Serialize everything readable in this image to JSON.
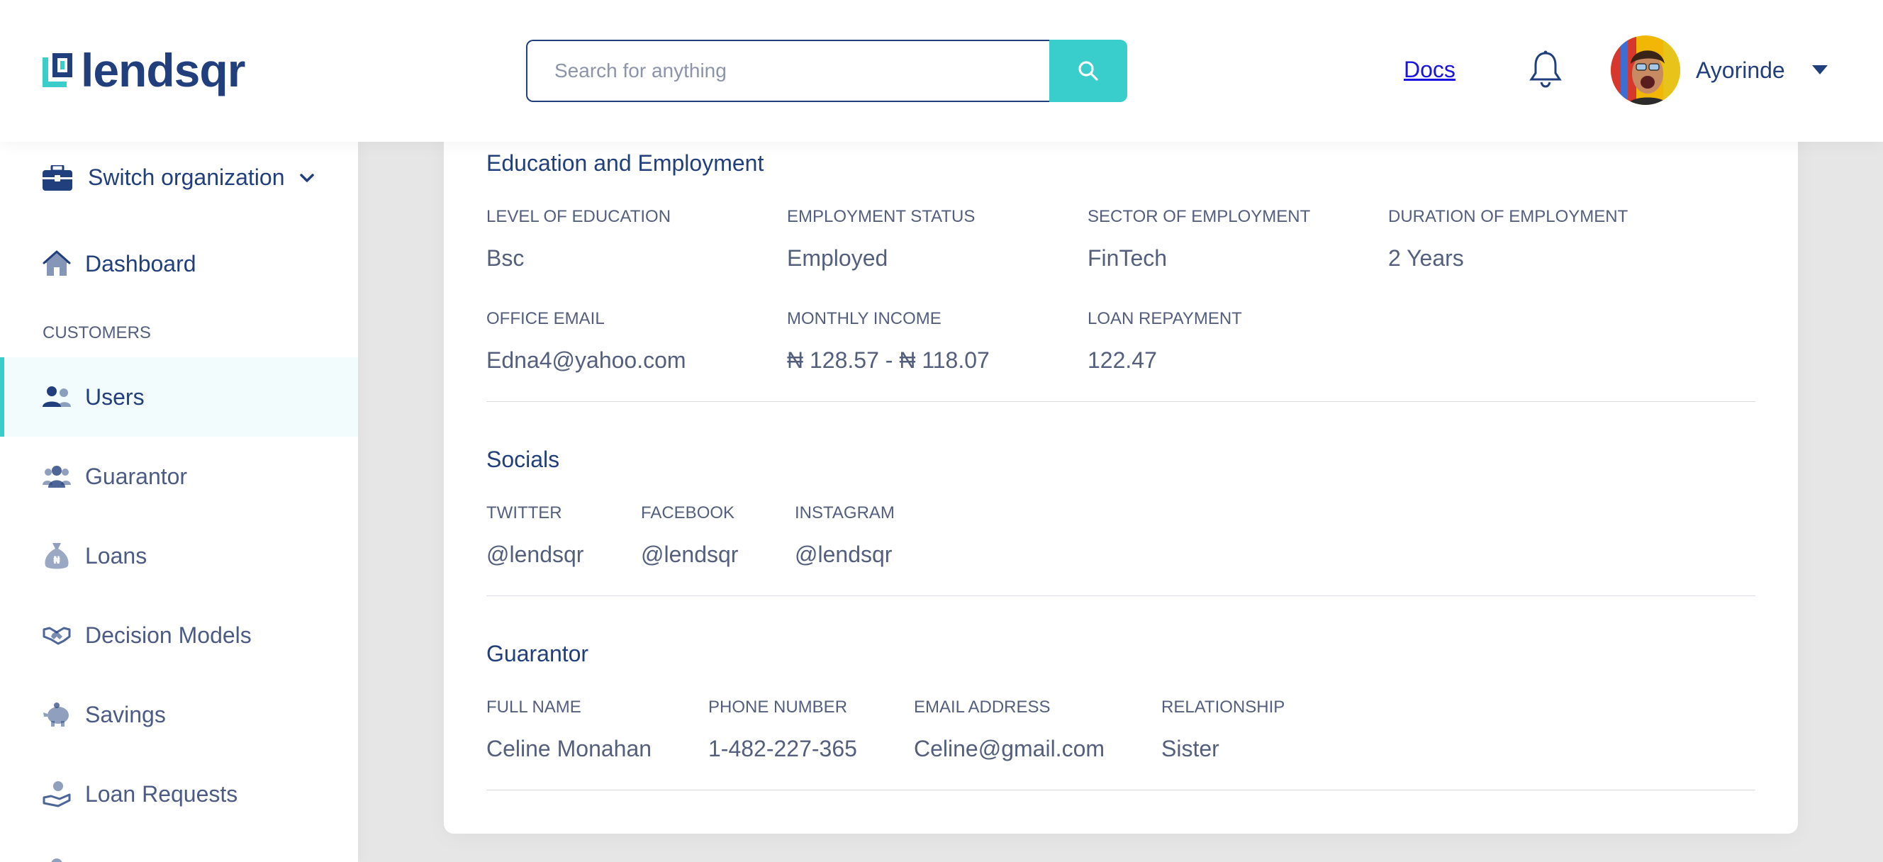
{
  "brand": {
    "name": "lendsqr"
  },
  "search": {
    "placeholder": "Search for anything"
  },
  "header": {
    "docs_label": "Docs",
    "user_name": "Ayorinde"
  },
  "sidebar": {
    "switch_org": "Switch organization",
    "dashboard": "Dashboard",
    "section_customers": "CUSTOMERS",
    "items": [
      {
        "label": "Users",
        "icon": "users-icon",
        "active": true
      },
      {
        "label": "Guarantor",
        "icon": "guarantor-icon"
      },
      {
        "label": "Loans",
        "icon": "loans-icon"
      },
      {
        "label": "Decision Models",
        "icon": "handshake-icon"
      },
      {
        "label": "Savings",
        "icon": "piggy-bank-icon"
      },
      {
        "label": "Loan Requests",
        "icon": "loan-request-icon"
      }
    ]
  },
  "education": {
    "title": "Education and Employment",
    "fields": [
      {
        "label": "LEVEL OF EDUCATION",
        "value": "Bsc"
      },
      {
        "label": "EMPLOYMENT STATUS",
        "value": "Employed"
      },
      {
        "label": "SECTOR OF EMPLOYMENT",
        "value": "FinTech"
      },
      {
        "label": "DURATION OF EMPLOYMENT",
        "value": "2 Years"
      },
      {
        "label": "OFFICE EMAIL",
        "value": "Edna4@yahoo.com"
      },
      {
        "label": "MONTHLY INCOME",
        "value": "₦ 128.57 - ₦ 118.07"
      },
      {
        "label": "LOAN REPAYMENT",
        "value": "122.47"
      }
    ]
  },
  "socials": {
    "title": "Socials",
    "fields": [
      {
        "label": "TWITTER",
        "value": "@lendsqr"
      },
      {
        "label": "FACEBOOK",
        "value": "@lendsqr"
      },
      {
        "label": "INSTAGRAM",
        "value": "@lendsqr"
      }
    ]
  },
  "guarantor": {
    "title": "Guarantor",
    "fields": [
      {
        "label": "FULL NAME",
        "value": "Celine Monahan"
      },
      {
        "label": "PHONE NUMBER",
        "value": "1-482-227-365"
      },
      {
        "label": "EMAIL ADDRESS",
        "value": "Celine@gmail.com"
      },
      {
        "label": "RELATIONSHIP",
        "value": "Sister"
      }
    ]
  },
  "colors": {
    "primary": "#213f7d",
    "accent": "#39cdcc",
    "muted": "#545f7d",
    "background": "#e6e6e6"
  }
}
